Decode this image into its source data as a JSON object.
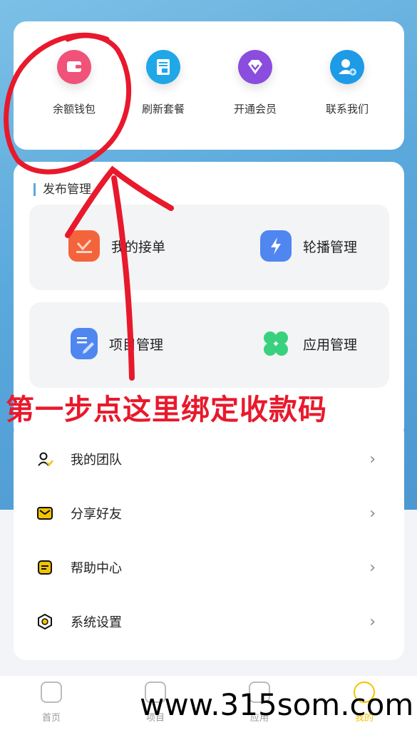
{
  "quick_actions": [
    {
      "label": "余额钱包",
      "icon": "wallet-icon",
      "color": "#f0527a"
    },
    {
      "label": "刷新套餐",
      "icon": "refresh-package-icon",
      "color": "#1fa7e8"
    },
    {
      "label": "开通会员",
      "icon": "vip-diamond-icon",
      "color": "#8a4dde"
    },
    {
      "label": "联系我们",
      "icon": "contact-user-icon",
      "color": "#1d9be6"
    }
  ],
  "publish": {
    "title": "发布管理",
    "items": [
      {
        "label": "我的接单",
        "icon": "orders-icon",
        "color": "#f4643c"
      },
      {
        "label": "轮播管理",
        "icon": "carousel-bolt-icon",
        "color": "#4f86f0"
      },
      {
        "label": "项目管理",
        "icon": "project-edit-icon",
        "color": "#4f86f0"
      },
      {
        "label": "应用管理",
        "icon": "apps-clover-icon",
        "color": "#38d17d"
      }
    ]
  },
  "menu": [
    {
      "label": "我的团队",
      "icon": "team-icon"
    },
    {
      "label": "分享好友",
      "icon": "share-mail-icon"
    },
    {
      "label": "帮助中心",
      "icon": "help-icon"
    },
    {
      "label": "系统设置",
      "icon": "settings-hex-icon"
    }
  ],
  "tabs": [
    {
      "label": "首页",
      "icon": "home-icon"
    },
    {
      "label": "项目",
      "icon": "project-icon"
    },
    {
      "label": "应用",
      "icon": "app-icon"
    },
    {
      "label": "我的",
      "icon": "profile-icon",
      "active": true
    }
  ],
  "annotation": {
    "text": "第一步点这里绑定收款码",
    "watermark": "www.315som.com"
  },
  "chevron": "›"
}
